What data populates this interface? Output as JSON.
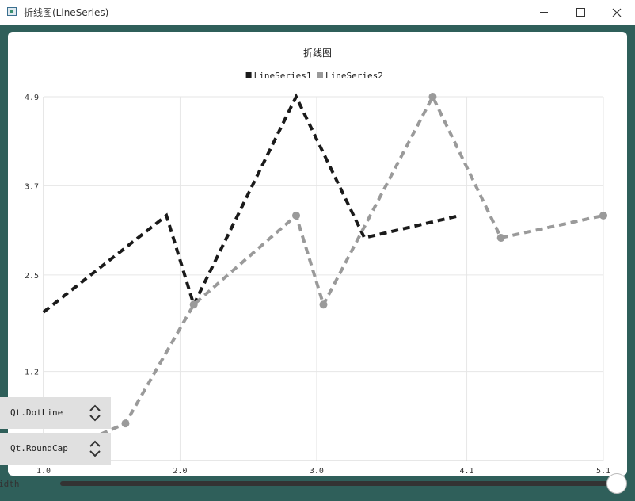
{
  "window": {
    "title": "折线图(LineSeries)",
    "minimize_icon": "minimize-icon",
    "maximize_icon": "maximize-icon",
    "close_icon": "close-icon"
  },
  "chart_data": {
    "type": "line",
    "title": "折线图",
    "xlabel": "",
    "ylabel": "",
    "xlim": [
      1.0,
      5.1
    ],
    "ylim": [
      0.0,
      4.9
    ],
    "xticks": [
      "1.0",
      "2.0",
      "3.0",
      "4.1",
      "5.1"
    ],
    "yticks": [
      "1.2",
      "2.5",
      "3.7",
      "4.9"
    ],
    "grid": true,
    "legend_position": "top",
    "series": [
      {
        "name": "LineSeries1",
        "color": "#1a1a1a",
        "style": "dashed",
        "x": [
          1.0,
          1.9,
          2.1,
          2.85,
          3.35,
          4.05
        ],
        "y": [
          2.0,
          3.3,
          2.1,
          4.9,
          3.0,
          3.3
        ]
      },
      {
        "name": "LineSeries2",
        "color": "#9a9a9a",
        "style": "dashed",
        "markers": true,
        "x": [
          1.1,
          1.6,
          2.1,
          2.85,
          3.05,
          3.85,
          4.35,
          5.1
        ],
        "y": [
          0.1,
          0.5,
          2.1,
          3.3,
          2.1,
          4.9,
          3.0,
          3.3
        ]
      }
    ]
  },
  "controls": {
    "pen_style": "Qt.DotLine",
    "cap_style": "Qt.RoundCap",
    "width_label": "idth",
    "width_value": 1.0
  },
  "icons": {
    "combo_arrow": "up-down-chevron-icon"
  }
}
